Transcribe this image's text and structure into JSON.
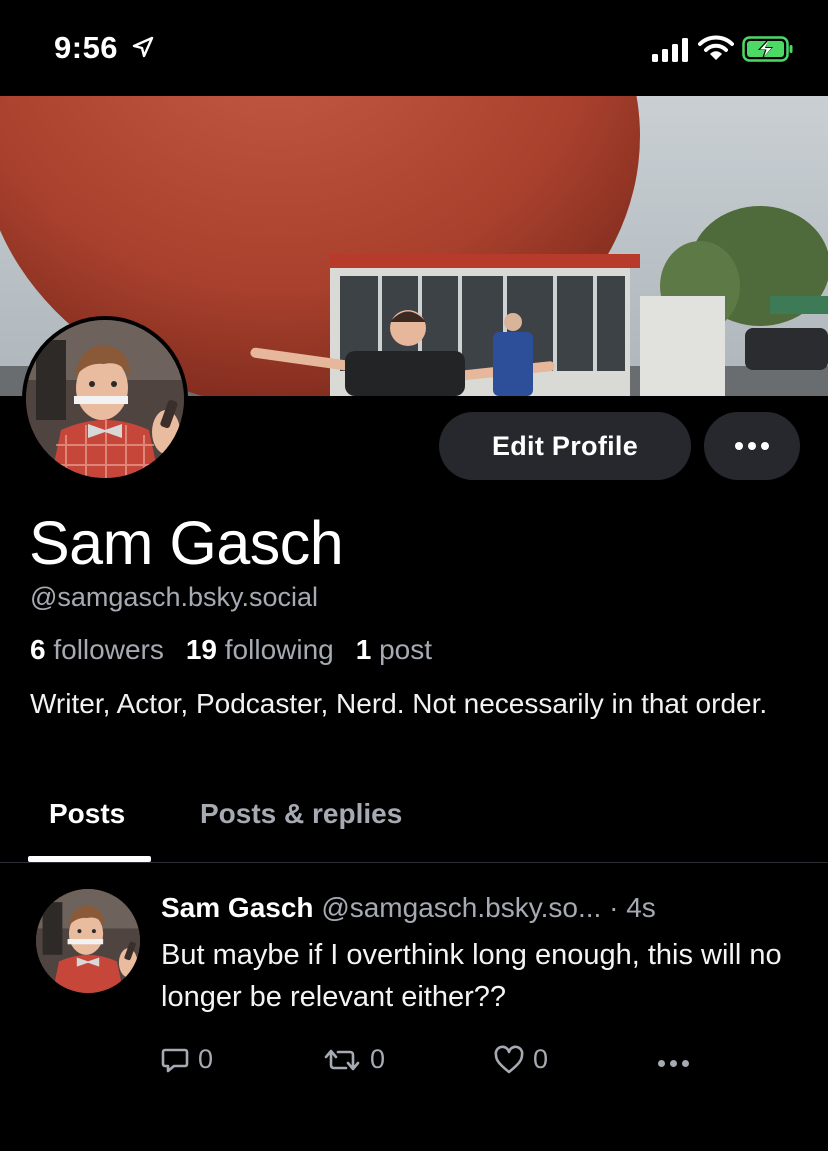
{
  "status_bar": {
    "time": "9:56",
    "icons": [
      "location-arrow-icon",
      "cellular-signal-icon",
      "wifi-icon",
      "battery-charging-icon"
    ],
    "battery_color": "#4cd964"
  },
  "profile": {
    "display_name": "Sam Gasch",
    "handle": "@samgasch.bsky.social",
    "followers_count": "6",
    "followers_label": "followers",
    "following_count": "19",
    "following_label": "following",
    "posts_count": "1",
    "posts_label": "post",
    "bio": "Writer, Actor, Podcaster, Nerd. Not necessarily in that order.",
    "edit_button_label": "Edit Profile"
  },
  "tabs": [
    {
      "label": "Posts",
      "active": true
    },
    {
      "label": "Posts & replies",
      "active": false
    }
  ],
  "feed": [
    {
      "author": "Sam Gasch",
      "handle": "@samgasch.bsky.so...",
      "separator": "·",
      "time": "4s",
      "text": "But maybe if I overthink long enough, this will no longer be relevant either??",
      "reply_count": "0",
      "repost_count": "0",
      "like_count": "0"
    }
  ],
  "colors": {
    "background": "#000000",
    "button_bg": "#26282d",
    "muted_text": "#a6aab2",
    "divider": "#2c2f34"
  }
}
